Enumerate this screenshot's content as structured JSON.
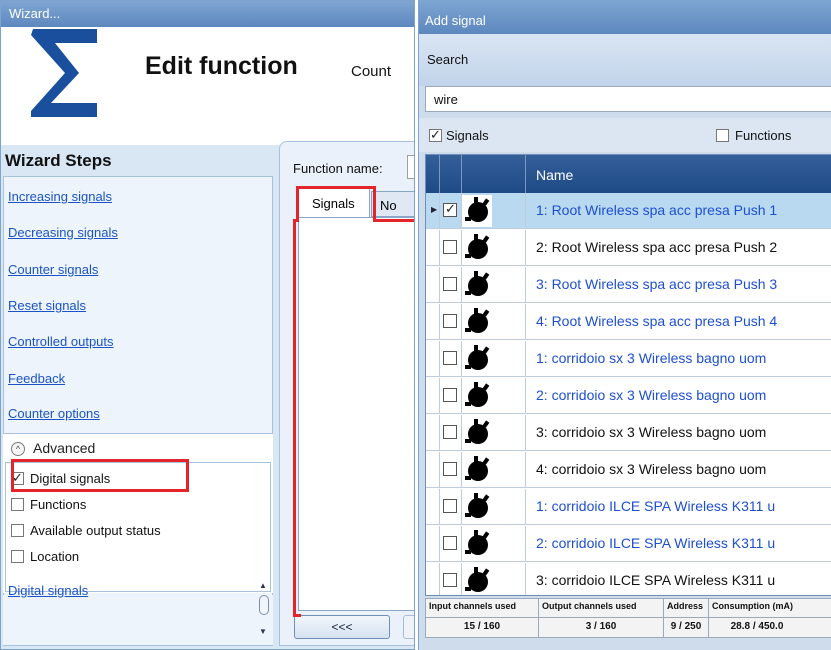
{
  "wizard": {
    "window_title": "Wizard...",
    "header_title": "Edit function",
    "header_sub": "Count",
    "steps_heading": "Wizard Steps",
    "steps": [
      "Increasing signals",
      "Decreasing signals",
      "Counter signals",
      "Reset signals",
      "Controlled outputs",
      "Feedback",
      "Counter options"
    ],
    "advanced_label": "Advanced",
    "filters": [
      {
        "label": "Digital signals",
        "checked": true
      },
      {
        "label": "Functions",
        "checked": false
      },
      {
        "label": "Available output status",
        "checked": false
      },
      {
        "label": "Location",
        "checked": false
      }
    ],
    "bottom_step": "Digital signals",
    "function_name_label": "Function name:",
    "tabs": [
      "Signals",
      "No"
    ],
    "back_button": "<<<",
    "accent_color": "#1a53c6",
    "highlight_color": "#e3242b"
  },
  "add_signal": {
    "window_title": "Add signal",
    "search_label": "Search",
    "search_value": "wire",
    "signals_checkbox": {
      "label": "Signals",
      "checked": true
    },
    "functions_checkbox": {
      "label": "Functions",
      "checked": false
    },
    "column_name": "Name",
    "rows": [
      {
        "name": "1: Root Wireless spa acc presa Push 1",
        "checked": true,
        "selected": true,
        "color": "blue"
      },
      {
        "name": "2: Root Wireless spa acc presa Push 2",
        "checked": false,
        "selected": false,
        "color": "black"
      },
      {
        "name": "3: Root Wireless spa acc presa Push 3",
        "checked": false,
        "selected": false,
        "color": "blue"
      },
      {
        "name": "4: Root Wireless spa acc presa Push 4",
        "checked": false,
        "selected": false,
        "color": "blue"
      },
      {
        "name": "1: corridoio sx 3 Wireless bagno uom",
        "checked": false,
        "selected": false,
        "color": "blue"
      },
      {
        "name": "2: corridoio sx 3 Wireless bagno uom",
        "checked": false,
        "selected": false,
        "color": "blue"
      },
      {
        "name": "3: corridoio sx 3 Wireless bagno uom",
        "checked": false,
        "selected": false,
        "color": "black"
      },
      {
        "name": "4: corridoio sx 3 Wireless bagno uom",
        "checked": false,
        "selected": false,
        "color": "black"
      },
      {
        "name": "1: corridoio ILCE SPA Wireless K311 u",
        "checked": false,
        "selected": false,
        "color": "blue"
      },
      {
        "name": "2: corridoio ILCE SPA Wireless K311 u",
        "checked": false,
        "selected": false,
        "color": "blue"
      },
      {
        "name": "3: corridoio ILCE SPA Wireless K311 u",
        "checked": false,
        "selected": false,
        "color": "black"
      }
    ],
    "stats": {
      "headers": [
        "Input channels used",
        "Output channels used",
        "Address",
        "Consumption (mA)"
      ],
      "values": [
        "15 / 160",
        "3 / 160",
        "9 / 250",
        "28.8 / 450.0"
      ]
    }
  }
}
